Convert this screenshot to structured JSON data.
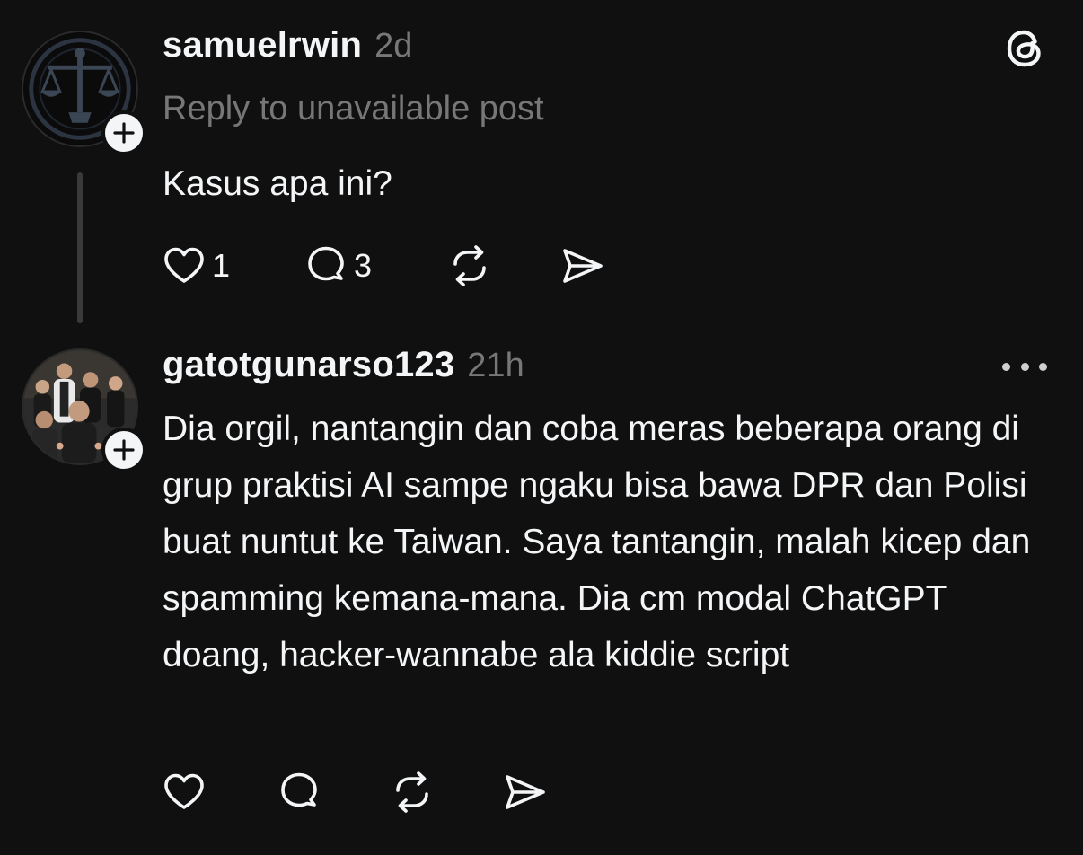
{
  "posts": [
    {
      "username": "samuelrwin",
      "timestamp": "2d",
      "reply_context": "Reply to unavailable post",
      "text": "Kasus apa ini?",
      "likes": "1",
      "replies": "3",
      "avatar_icon": "scales-of-justice-logo",
      "top_right_icon": "threads-logo-icon"
    },
    {
      "username": "gatotgunarso123",
      "timestamp": "21h",
      "text": "Dia orgil, nantangin dan coba meras beberapa orang di grup praktisi AI sampe ngaku bisa bawa DPR dan Polisi buat nuntut ke Taiwan. Saya tantangin, malah kicep dan spamming kemana-mana. Dia cm modal ChatGPT doang, hacker-wannabe ala kiddie script",
      "avatar_icon": "group-photo-avatar",
      "top_right_icon": "more-options-icon"
    }
  ],
  "colors": {
    "background": "#101010",
    "primary_text": "#f3f5f7",
    "secondary_text": "#777777",
    "thread_line": "#3a3a3a"
  }
}
